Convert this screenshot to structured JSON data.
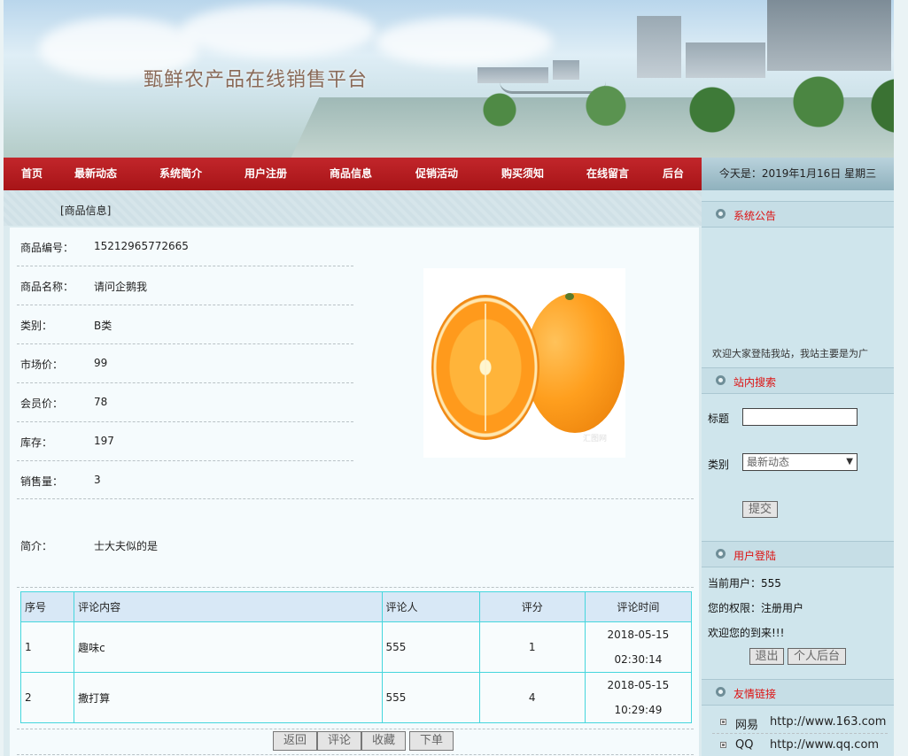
{
  "header": {
    "site_title": "甄鲜农产品在线销售平台"
  },
  "nav": {
    "items": [
      "首页",
      "最新动态",
      "系统简介",
      "用户注册",
      "商品信息",
      "促销活动",
      "购买须知",
      "在线留言",
      "后台"
    ],
    "date_text": "今天是：2019年1月16日 星期三"
  },
  "breadcrumb": "[商品信息]",
  "product": {
    "fields": [
      {
        "label": "商品编号：",
        "value": "15212965772665"
      },
      {
        "label": "商品名称：",
        "value": "请问企鹅我"
      },
      {
        "label": "类别：",
        "value": "B类"
      },
      {
        "label": "市场价：",
        "value": "99"
      },
      {
        "label": "会员价：",
        "value": "78"
      },
      {
        "label": "库存：",
        "value": "197"
      },
      {
        "label": "销售量：",
        "value": "3"
      }
    ],
    "intro_label": "简介：",
    "intro_value": "士大夫似的是",
    "image_watermark": "汇图网"
  },
  "comments": {
    "headers": [
      "序号",
      "评论内容",
      "评论人",
      "评分",
      "评论时间"
    ],
    "rows": [
      {
        "no": "1",
        "content": "趣味c",
        "user": "555",
        "score": "1",
        "date": "2018-05-15",
        "time": "02:30:14"
      },
      {
        "no": "2",
        "content": "撒打算",
        "user": "555",
        "score": "4",
        "date": "2018-05-15",
        "time": "10:29:49"
      }
    ]
  },
  "actions": {
    "back": "返回",
    "comment": "评论",
    "favorite": "收藏",
    "order": "下单"
  },
  "sidebar": {
    "notice_title": "系统公告",
    "notice_text": "欢迎大家登陆我站，我站主要是为广",
    "search_title": "站内搜索",
    "search_title_label": "标题",
    "search_title_value": "",
    "search_category_label": "类别",
    "search_category_value": "最新动态",
    "search_submit": "提交",
    "login_title": "用户登陆",
    "current_user": "当前用户：555",
    "permission": "您的权限：注册用户",
    "welcome": "欢迎您的到来!!!",
    "logout": "退出",
    "personal": "个人后台",
    "links_title": "友情链接",
    "links": [
      {
        "name": "网易",
        "url": "http://www.163.com"
      },
      {
        "name": "QQ",
        "url": "http://www.qq.com"
      }
    ]
  }
}
